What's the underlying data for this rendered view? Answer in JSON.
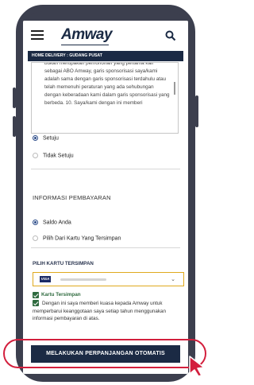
{
  "header": {
    "logo": "Amway",
    "delivery_bar": "HOME DELIVERY : GUDANG PUSAT"
  },
  "terms": {
    "text": "bukan merupakan pemohonan yang pertama kali sebagai ABO Amway, garis sponsorisasi saya/kami adalah sama dengan garis sponsorisasi terdahulu atau telah memenuhi peraturan yang ada sehubungan dengan keberadaan kami dalam garis sponsorisasi yang berbeda. 10. Saya/kami dengan ini memberi"
  },
  "agreement": {
    "agree": "Setuju",
    "disagree": "Tidak Setuju"
  },
  "payment": {
    "section_title": "INFORMASI PEMBAYARAN",
    "option_balance": "Saldo Anda",
    "option_saved_card": "Pilih Dari Kartu Yang Tersimpan",
    "saved_card_label": "PILIH KARTU TERSIMPAN",
    "card_brand": "VISA"
  },
  "consent": {
    "saved_card_checkbox": "Kartu Tersimpan",
    "authorization": "Dengan ini saya memberi kuasa kepada Amway untuk memperbarui keanggotaan saya setiap tahun menggunakan informasi pembayaran di atas."
  },
  "cta": {
    "label": "MELAKUKAN PERPANJANGAN OTOMATIS"
  },
  "icons": [
    "menu-icon",
    "search-icon",
    "chevron-down-icon",
    "checkbox-icon",
    "cursor-icon"
  ],
  "colors": {
    "brand_navy": "#1b2a44",
    "highlight_red": "#d31f3d",
    "select_border": "#e0a91e",
    "checkbox_green": "#2f6b3f"
  }
}
